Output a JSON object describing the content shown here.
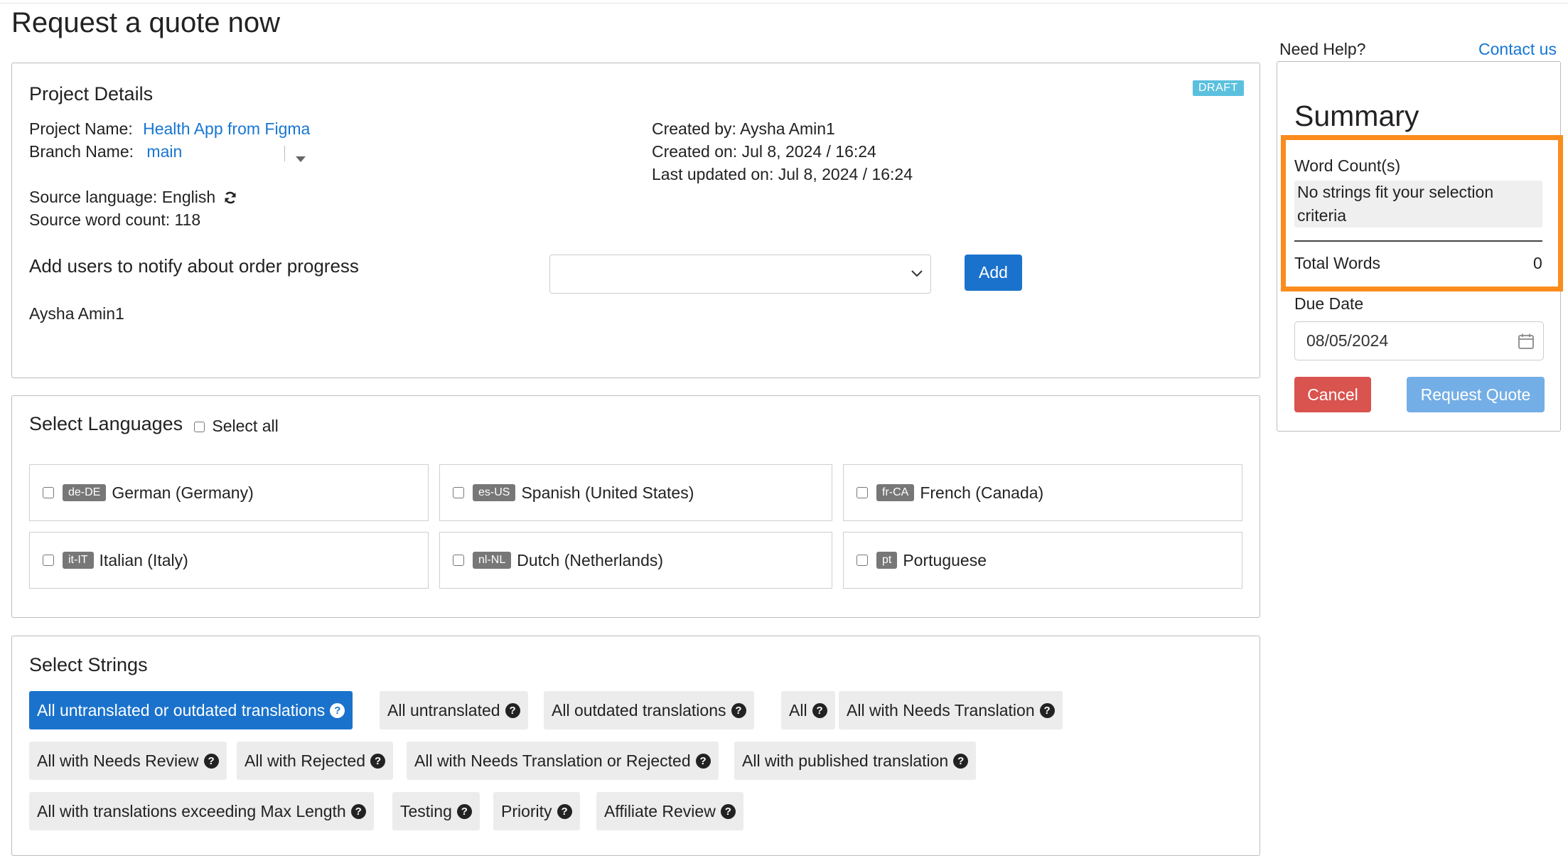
{
  "page": {
    "title": "Request a quote now"
  },
  "help": {
    "label": "Need Help?",
    "contact": "Contact us"
  },
  "project": {
    "heading": "Project Details",
    "status_badge": "DRAFT",
    "name_label": "Project Name:",
    "name_value": "Health App from Figma",
    "branch_label": "Branch Name:",
    "branch_value": "main",
    "created_by": "Created by:  Aysha Amin1",
    "created_on": "Created on: Jul 8, 2024 / 16:24",
    "updated_on": "Last updated on: Jul 8, 2024 / 16:24",
    "source_language": "Source language: English",
    "source_word_count": "Source word count: 118",
    "notify_label": "Add users to notify about order progress",
    "notify_select_value": "",
    "add_button": "Add",
    "notified_user": "Aysha Amin1"
  },
  "languages": {
    "heading": "Select Languages",
    "select_all": "Select all",
    "items": [
      {
        "code": "de-DE",
        "name": "German (Germany)",
        "checked": false
      },
      {
        "code": "es-US",
        "name": "Spanish (United States)",
        "checked": false
      },
      {
        "code": "fr-CA",
        "name": "French (Canada)",
        "checked": false
      },
      {
        "code": "it-IT",
        "name": "Italian (Italy)",
        "checked": false
      },
      {
        "code": "nl-NL",
        "name": "Dutch (Netherlands)",
        "checked": false
      },
      {
        "code": "pt",
        "name": "Portuguese",
        "checked": false
      }
    ]
  },
  "strings": {
    "heading": "Select Strings",
    "filters": [
      {
        "label": "All untranslated or outdated translations",
        "active": true
      },
      {
        "label": "All untranslated",
        "active": false
      },
      {
        "label": "All outdated translations",
        "active": false
      },
      {
        "label": "All",
        "active": false
      },
      {
        "label": "All with Needs Translation",
        "active": false
      },
      {
        "label": "All with Needs Review",
        "active": false
      },
      {
        "label": "All with Rejected",
        "active": false
      },
      {
        "label": "All with Needs Translation or Rejected",
        "active": false
      },
      {
        "label": "All with published translation",
        "active": false
      },
      {
        "label": "All with translations exceeding Max Length",
        "active": false
      },
      {
        "label": "Testing",
        "active": false
      },
      {
        "label": "Priority",
        "active": false
      },
      {
        "label": "Affiliate Review",
        "active": false
      }
    ]
  },
  "summary": {
    "heading": "Summary",
    "word_counts_label": "Word Count(s)",
    "empty_message_line1": "No strings fit your selection",
    "empty_message_line2": "criteria",
    "total_words_label": "Total Words",
    "total_words_value": "0",
    "due_date_label": "Due Date",
    "due_date_value": "08/05/2024",
    "cancel_button": "Cancel",
    "request_button": "Request Quote"
  },
  "colors": {
    "accent_blue": "#1a72cc",
    "link_blue": "#1776d3",
    "draft_badge": "#5bc0de",
    "cancel_red": "#d9534f",
    "request_disabled_blue": "#74aee6",
    "highlight_orange": "#fb8c1d"
  },
  "icons": {
    "refresh": "refresh-icon",
    "help": "question-circle-icon",
    "calendar": "calendar-icon",
    "dropdown": "chevron-down-icon"
  }
}
